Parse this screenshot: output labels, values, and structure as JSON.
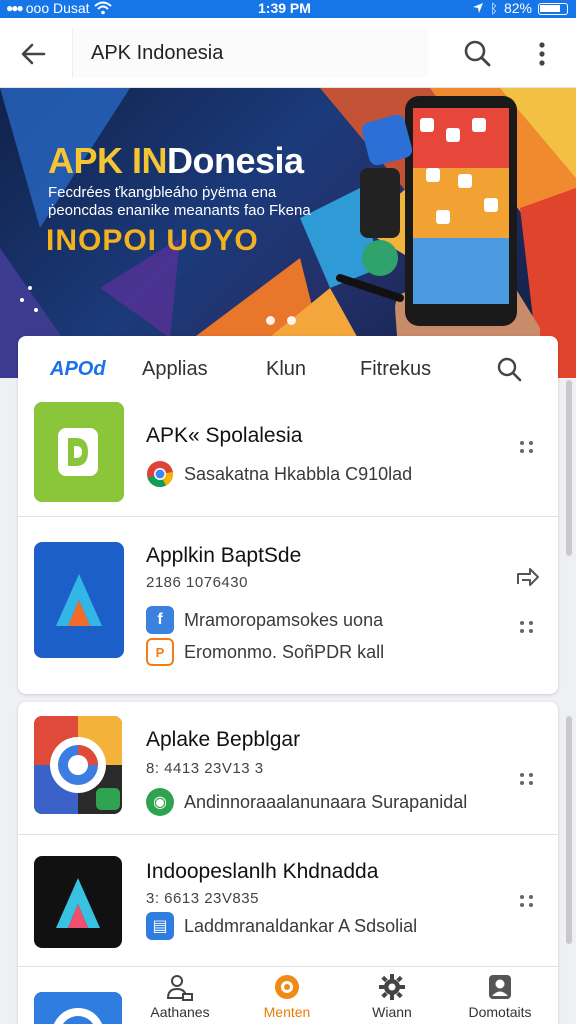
{
  "status_bar": {
    "carrier": "ooo Dusat",
    "time": "1:39 PM",
    "battery": "82%"
  },
  "app_bar": {
    "search_value": "APK Indonesia"
  },
  "banner": {
    "title_colored": "APK IN",
    "title_white": "Donesia",
    "line1": "Fecdrées ťkangbleáho ṗyëma ena",
    "line2": "ṗeoncdas enanike meanants fao Fkena",
    "subtitle": "INOPOI UOYO"
  },
  "tabs": [
    {
      "label": "APOd",
      "active": true
    },
    {
      "label": "Applias",
      "active": false
    },
    {
      "label": "Klun",
      "active": false
    },
    {
      "label": "Fitrekus",
      "active": false
    }
  ],
  "apps": [
    {
      "name": "APK« Spolalesia",
      "meta": "",
      "sub": [
        {
          "icon": "chrome-icon",
          "text": "Sasakatna Hkabbla C910lad"
        }
      ]
    },
    {
      "name": "Applkin BaptSde",
      "meta": "2186 1076430",
      "sub": [
        {
          "icon": "facebook-icon",
          "text": "Mramoropamsokes uona"
        },
        {
          "icon": "pdf-icon",
          "text": "Eromonmo. SoñPDR kall"
        }
      ]
    },
    {
      "name": "Aplake Bepblgar",
      "meta": "8: 4413 23V13 3",
      "sub": [
        {
          "icon": "game-icon",
          "text": "Andinnoraaalanunaara Surapanidal"
        }
      ]
    },
    {
      "name": "Indoopeslanlh Khdnadda",
      "meta": "3: 6613 23V835",
      "sub": [
        {
          "icon": "calendar-icon",
          "text": "Laddmranaldankar A Sdsolial"
        }
      ]
    }
  ],
  "bottom_nav": [
    {
      "label": "Aathanes",
      "icon": "people-icon",
      "active": false
    },
    {
      "label": "Menten",
      "icon": "target-icon",
      "active": true
    },
    {
      "label": "Wiann",
      "icon": "gear-icon",
      "active": false
    },
    {
      "label": "Domotaits",
      "icon": "account-icon",
      "active": false
    }
  ],
  "colors": {
    "accent": "#1a73e8",
    "active_nav": "#e67e00",
    "status_bar": "#1676e8"
  }
}
